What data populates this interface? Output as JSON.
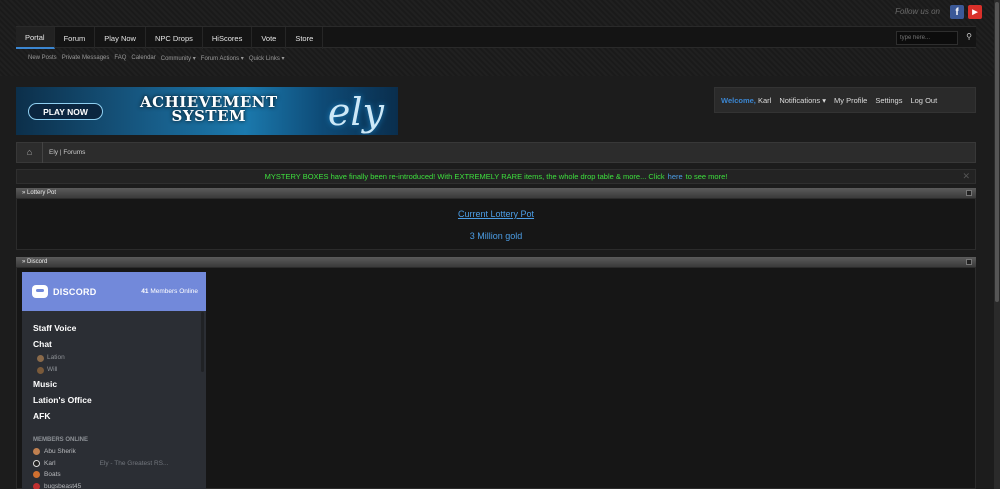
{
  "header": {
    "follow_text": "Follow us on",
    "facebook_icon": "f",
    "youtube_icon": "▶",
    "nav": [
      {
        "label": "Portal"
      },
      {
        "label": "Forum"
      },
      {
        "label": "Play Now"
      },
      {
        "label": "NPC Drops"
      },
      {
        "label": "HiScores"
      },
      {
        "label": "Vote"
      },
      {
        "label": "Store"
      }
    ],
    "search_placeholder": "type here...",
    "search_icon": "⚲",
    "subnav": [
      "New Posts",
      "Private Messages",
      "FAQ",
      "Calendar",
      "Community ▾",
      "Forum Actions ▾",
      "Quick Links ▾"
    ]
  },
  "banner": {
    "play_label": "PLAY NOW",
    "title_line1": "ACHIEVEMENT",
    "title_line2": "SYSTEM",
    "logo_text": "ely"
  },
  "userbar": {
    "welcome": "Welcome,",
    "username": "Karl",
    "notifications": "Notifications ▾",
    "profile": "My Profile",
    "settings": "Settings",
    "logout": "Log Out"
  },
  "breadcrumb": {
    "home_icon": "⌂",
    "path": "Ely | Forums"
  },
  "notice": {
    "text_before": "MYSTERY BOXES have finally been re-introduced! With EXTREMELY RARE items, the whole drop table & more... Click",
    "link": "here",
    "text_after": "to see more!",
    "close_icon": "✕"
  },
  "lottery": {
    "header": "» Lottery Pot",
    "link_text": "Current Lottery Pot",
    "value": "3 Million gold"
  },
  "discord": {
    "header": "» Discord",
    "brand": "DISCORD",
    "online_count": "41",
    "online_label": "Members Online",
    "channels": [
      {
        "name": "Staff Voice",
        "members": []
      },
      {
        "name": "Chat",
        "members": [
          {
            "name": "Lation",
            "color": "#8a6a4a"
          },
          {
            "name": "Will",
            "color": "#7a5a3a"
          }
        ]
      },
      {
        "name": "Music",
        "members": []
      },
      {
        "name": "Lation's Office",
        "members": []
      },
      {
        "name": "AFK",
        "members": []
      }
    ],
    "members_head": "MEMBERS ONLINE",
    "members": [
      {
        "name": "Abu Sherik",
        "color": "#c08050",
        "game": ""
      },
      {
        "name": "Karl",
        "color": "#222222",
        "game": "Ely - The Greatest RS..."
      },
      {
        "name": "Boats",
        "color": "#d07030",
        "game": ""
      },
      {
        "name": "bugsbeast45",
        "color": "#c03030",
        "game": ""
      }
    ]
  }
}
